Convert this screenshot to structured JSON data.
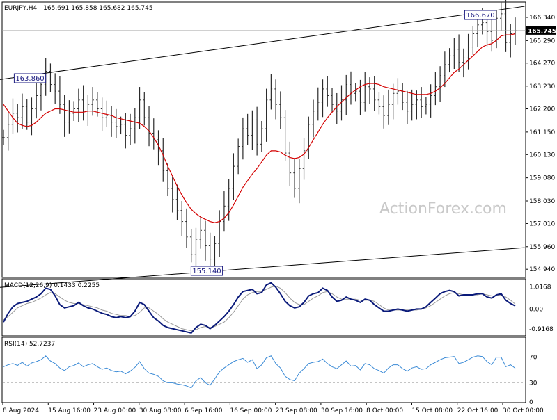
{
  "header": {
    "symbol": "EURJPY,H4",
    "ohlc": "165.691 165.858 165.682 165.745"
  },
  "watermark": "ActionForex.com",
  "colors": {
    "price_bars": "#2a2a2a",
    "moving_average": "#d40000",
    "macd_line": "#0a1a7a",
    "signal_line": "#999999",
    "rsi_line": "#3a8ad6",
    "trendline": "#000000",
    "last_price_tag": "#000000",
    "watermark": "#c9c9c9"
  },
  "chart_data": [
    {
      "type": "line",
      "title": "EURJPY,H4",
      "subtitle": "165.691 165.858 165.682 165.745",
      "price_axis_ticks": [
        "166.340",
        "165.290",
        "164.270",
        "163.230",
        "162.200",
        "161.150",
        "160.130",
        "159.080",
        "158.030",
        "157.010",
        "155.960",
        "154.940"
      ],
      "time_axis_ticks": [
        "8 Aug 2024",
        "15 Aug 16:00",
        "23 Aug 00:00",
        "30 Aug 08:00",
        "6 Sep 16:00",
        "16 Sep 00:00",
        "23 Sep 08:00",
        "30 Sep 16:00",
        "8 Oct 00:00",
        "15 Oct 08:00",
        "22 Oct 16:00",
        "30 Oct 00:00"
      ],
      "ylim": [
        154.6,
        167.0
      ],
      "last_price": "165.745",
      "labels": {
        "high_left": "163.860",
        "low": "155.140",
        "high_right": "166.670"
      },
      "trendlines": [
        {
          "name": "upper",
          "from": [
            0,
            163.55
          ],
          "to": [
            113,
            166.9
          ]
        },
        {
          "name": "lower",
          "from": [
            26,
            154.55
          ],
          "to": [
            113,
            155.95
          ]
        }
      ],
      "grid": false,
      "series": [
        {
          "values": [
            160.9,
            161.5,
            162.0,
            161.8,
            162.3,
            161.6,
            162.2,
            162.8,
            163.3,
            163.9,
            163.3,
            163.0,
            162.4,
            161.6,
            162.0,
            162.2,
            162.6,
            162.1,
            162.4,
            162.6,
            162.2,
            161.8,
            161.9,
            161.6,
            161.4,
            161.5,
            161.0,
            161.3,
            161.8,
            162.6,
            161.8,
            161.1,
            160.8,
            160.3,
            159.4,
            158.6,
            158.1,
            157.6,
            157.1,
            156.4,
            155.6,
            156.3,
            156.7,
            156.0,
            155.4,
            156.1,
            157.1,
            157.8,
            158.6,
            159.6,
            160.5,
            161.3,
            161.0,
            161.7,
            160.6,
            161.3,
            162.6,
            163.1,
            162.4,
            161.8,
            160.2,
            159.3,
            158.6,
            159.5,
            160.3,
            161.5,
            162.1,
            162.5,
            163.1,
            162.8,
            162.4,
            162.1,
            162.6,
            163.3,
            162.9,
            163.0,
            162.5,
            163.2,
            163.1,
            162.6,
            162.3,
            161.9,
            162.4,
            162.9,
            163.0,
            162.5,
            162.1,
            162.4,
            162.6,
            162.3,
            162.4,
            162.8,
            163.2,
            163.7,
            164.2,
            164.6,
            164.9,
            164.3,
            164.5,
            165.0,
            165.6,
            166.0,
            166.1,
            165.7,
            165.3,
            166.3,
            166.5,
            165.2,
            165.6,
            165.745
          ]
        },
        {
          "name": "MA",
          "values": [
            162.4,
            162.1,
            161.8,
            161.55,
            161.45,
            161.4,
            161.45,
            161.6,
            161.8,
            162.0,
            162.1,
            162.2,
            162.2,
            162.15,
            162.1,
            162.05,
            162.05,
            162.05,
            162.1,
            162.1,
            162.05,
            162.0,
            161.95,
            161.9,
            161.8,
            161.75,
            161.7,
            161.65,
            161.6,
            161.55,
            161.4,
            161.2,
            160.9,
            160.55,
            160.1,
            159.6,
            159.15,
            158.7,
            158.3,
            157.95,
            157.65,
            157.45,
            157.3,
            157.2,
            157.1,
            157.05,
            157.1,
            157.25,
            157.5,
            157.85,
            158.25,
            158.65,
            158.95,
            159.25,
            159.5,
            159.8,
            160.1,
            160.3,
            160.3,
            160.25,
            160.1,
            160.0,
            159.95,
            160.0,
            160.15,
            160.45,
            160.8,
            161.15,
            161.5,
            161.8,
            162.05,
            162.3,
            162.5,
            162.7,
            162.9,
            163.05,
            163.2,
            163.3,
            163.35,
            163.35,
            163.3,
            163.2,
            163.15,
            163.1,
            163.05,
            163.0,
            162.95,
            162.9,
            162.85,
            162.85,
            162.85,
            162.9,
            163.0,
            163.15,
            163.35,
            163.6,
            163.85,
            164.0,
            164.2,
            164.4,
            164.6,
            164.8,
            165.0,
            165.1,
            165.15,
            165.3,
            165.5,
            165.55,
            165.55,
            165.6
          ]
        }
      ]
    },
    {
      "type": "line",
      "title": "MACD(12,26,9) 0.1433 0.2255",
      "axis_ticks": [
        "1.0168",
        "0.00",
        "-0.9168"
      ],
      "ylim": [
        -1.2,
        1.35
      ],
      "zero_line": true,
      "series": [
        {
          "name": "MACD",
          "values": [
            -0.6,
            -0.2,
            0.1,
            0.25,
            0.3,
            0.35,
            0.45,
            0.55,
            0.7,
            0.95,
            0.9,
            0.6,
            0.2,
            0.05,
            0.1,
            0.15,
            0.3,
            0.15,
            0.05,
            0.0,
            -0.1,
            -0.2,
            -0.25,
            -0.35,
            -0.4,
            -0.35,
            -0.4,
            -0.35,
            -0.1,
            0.3,
            0.2,
            -0.1,
            -0.4,
            -0.55,
            -0.75,
            -0.85,
            -0.9,
            -0.95,
            -1.0,
            -1.05,
            -1.1,
            -0.85,
            -0.7,
            -0.75,
            -0.9,
            -0.75,
            -0.55,
            -0.35,
            -0.1,
            0.2,
            0.55,
            0.8,
            0.85,
            0.9,
            0.7,
            0.75,
            1.1,
            1.2,
            1.0,
            0.7,
            0.35,
            0.15,
            0.05,
            0.1,
            0.3,
            0.6,
            0.7,
            0.75,
            0.95,
            0.85,
            0.55,
            0.35,
            0.4,
            0.55,
            0.45,
            0.4,
            0.3,
            0.45,
            0.4,
            0.2,
            0.05,
            -0.1,
            -0.1,
            -0.05,
            0.0,
            -0.05,
            -0.1,
            -0.05,
            0.0,
            0.0,
            0.1,
            0.3,
            0.5,
            0.7,
            0.8,
            0.85,
            0.8,
            0.6,
            0.65,
            0.65,
            0.65,
            0.7,
            0.7,
            0.55,
            0.5,
            0.65,
            0.7,
            0.4,
            0.25,
            0.1433
          ]
        },
        {
          "name": "Signal",
          "values": [
            -0.5,
            -0.35,
            -0.15,
            0.05,
            0.15,
            0.25,
            0.3,
            0.4,
            0.5,
            0.65,
            0.75,
            0.7,
            0.55,
            0.4,
            0.3,
            0.25,
            0.25,
            0.2,
            0.15,
            0.1,
            0.05,
            -0.05,
            -0.1,
            -0.2,
            -0.25,
            -0.3,
            -0.3,
            -0.35,
            -0.3,
            -0.15,
            0.05,
            0.05,
            -0.1,
            -0.25,
            -0.45,
            -0.6,
            -0.7,
            -0.8,
            -0.9,
            -0.95,
            -1.0,
            -0.95,
            -0.85,
            -0.8,
            -0.85,
            -0.8,
            -0.7,
            -0.6,
            -0.4,
            -0.15,
            0.15,
            0.45,
            0.65,
            0.75,
            0.8,
            0.8,
            0.9,
            1.0,
            1.05,
            0.95,
            0.75,
            0.5,
            0.3,
            0.2,
            0.2,
            0.35,
            0.5,
            0.6,
            0.75,
            0.8,
            0.7,
            0.55,
            0.45,
            0.45,
            0.45,
            0.45,
            0.4,
            0.4,
            0.4,
            0.35,
            0.2,
            0.05,
            -0.05,
            -0.05,
            -0.05,
            -0.05,
            -0.05,
            -0.05,
            -0.05,
            0.0,
            0.05,
            0.15,
            0.3,
            0.45,
            0.6,
            0.7,
            0.75,
            0.7,
            0.65,
            0.65,
            0.65,
            0.65,
            0.7,
            0.65,
            0.6,
            0.6,
            0.65,
            0.55,
            0.4,
            0.2255
          ]
        }
      ]
    },
    {
      "type": "line",
      "title": "RSI(14) 52.7237",
      "axis_ticks": [
        "70",
        "30",
        "0"
      ],
      "ylim": [
        0,
        100
      ],
      "reference_levels": [
        70,
        30
      ],
      "series": [
        {
          "name": "RSI",
          "values": [
            55,
            58,
            60,
            57,
            62,
            56,
            61,
            63,
            66,
            72,
            64,
            60,
            53,
            49,
            55,
            57,
            61,
            55,
            58,
            60,
            55,
            51,
            53,
            49,
            47,
            48,
            44,
            48,
            54,
            63,
            52,
            45,
            43,
            40,
            33,
            30,
            30,
            28,
            27,
            25,
            22,
            33,
            38,
            30,
            26,
            36,
            47,
            53,
            58,
            63,
            66,
            68,
            62,
            66,
            52,
            58,
            69,
            72,
            60,
            53,
            40,
            35,
            33,
            45,
            52,
            60,
            62,
            63,
            67,
            60,
            55,
            52,
            58,
            64,
            56,
            57,
            50,
            60,
            58,
            52,
            49,
            45,
            53,
            58,
            58,
            52,
            48,
            53,
            55,
            51,
            52,
            58,
            62,
            66,
            69,
            70,
            71,
            60,
            62,
            66,
            70,
            72,
            71,
            63,
            58,
            70,
            70,
            55,
            58,
            52.7
          ]
        }
      ]
    }
  ]
}
